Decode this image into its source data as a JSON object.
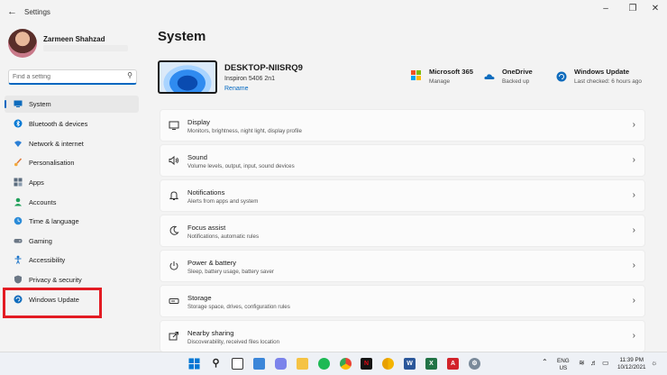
{
  "window": {
    "title": "Settings",
    "back_icon": "arrow-left-icon",
    "minimize_icon": "minimize-icon",
    "maximize_icon": "maximize-icon",
    "close_icon": "close-icon"
  },
  "user": {
    "name": "Zarmeen Shahzad"
  },
  "search": {
    "placeholder": "Find a setting"
  },
  "sidebar": {
    "items": [
      {
        "label": "System",
        "icon": "monitor-icon",
        "active": true
      },
      {
        "label": "Bluetooth & devices",
        "icon": "bluetooth-icon"
      },
      {
        "label": "Network & internet",
        "icon": "wifi-icon"
      },
      {
        "label": "Personalisation",
        "icon": "brush-icon"
      },
      {
        "label": "Apps",
        "icon": "apps-icon"
      },
      {
        "label": "Accounts",
        "icon": "person-icon"
      },
      {
        "label": "Time & language",
        "icon": "globe-clock-icon"
      },
      {
        "label": "Gaming",
        "icon": "gamepad-icon"
      },
      {
        "label": "Accessibility",
        "icon": "accessibility-icon"
      },
      {
        "label": "Privacy & security",
        "icon": "shield-icon"
      },
      {
        "label": "Windows Update",
        "icon": "update-icon",
        "highlighted": true
      }
    ]
  },
  "main": {
    "title": "System",
    "device": {
      "name": "DESKTOP-NIISRQ9",
      "model": "Inspiron 5406 2n1",
      "rename": "Rename"
    },
    "quick": [
      {
        "title": "Microsoft 365",
        "sub": "Manage",
        "icon": "microsoft-365-icon"
      },
      {
        "title": "OneDrive",
        "sub": "Backed up",
        "icon": "onedrive-icon"
      },
      {
        "title": "Windows Update",
        "sub": "Last checked: 6 hours ago",
        "icon": "windows-update-icon"
      }
    ],
    "cards": [
      {
        "title": "Display",
        "sub": "Monitors, brightness, night light, display profile",
        "icon": "display-icon"
      },
      {
        "title": "Sound",
        "sub": "Volume levels, output, input, sound devices",
        "icon": "speaker-icon"
      },
      {
        "title": "Notifications",
        "sub": "Alerts from apps and system",
        "icon": "bell-icon"
      },
      {
        "title": "Focus assist",
        "sub": "Notifications, automatic rules",
        "icon": "moon-icon"
      },
      {
        "title": "Power & battery",
        "sub": "Sleep, battery usage, battery saver",
        "icon": "power-icon"
      },
      {
        "title": "Storage",
        "sub": "Storage space, drives, configuration rules",
        "icon": "storage-icon"
      },
      {
        "title": "Nearby sharing",
        "sub": "Discoverability, received files location",
        "icon": "share-icon"
      }
    ]
  },
  "taskbar": {
    "apps": [
      "windows-start-icon",
      "search-icon",
      "task-view-icon",
      "widgets-icon",
      "teams-chat-icon",
      "file-explorer-icon",
      "spotify-icon",
      "chrome-icon",
      "netflix-icon",
      "chrome-canary-icon",
      "word-icon",
      "excel-icon",
      "acrobat-icon",
      "settings-icon"
    ],
    "lang_line1": "ENG",
    "lang_line2": "US",
    "time": "11:39 PM",
    "date": "10/12/2021"
  },
  "colors": {
    "accent": "#0067c0",
    "highlight_border": "#e31b23"
  }
}
